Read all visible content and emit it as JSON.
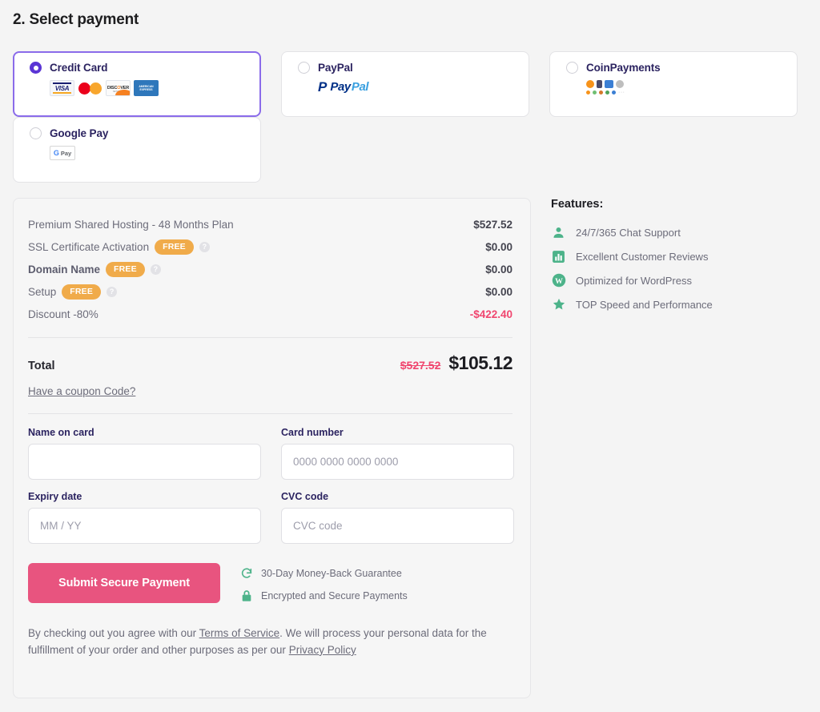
{
  "step": {
    "title": "2. Select payment"
  },
  "payment_methods": [
    {
      "id": "credit-card",
      "label": "Credit Card",
      "selected": true,
      "logos": [
        "visa",
        "mastercard",
        "discover",
        "amex"
      ]
    },
    {
      "id": "paypal",
      "label": "PayPal",
      "selected": false,
      "logos": [
        "paypal"
      ],
      "logo_text_1": "Pay",
      "logo_text_2": "Pal"
    },
    {
      "id": "coinpayments",
      "label": "CoinPayments",
      "selected": false,
      "logos": [
        "crypto"
      ]
    },
    {
      "id": "google-pay",
      "label": "Google Pay",
      "selected": false,
      "logos": [
        "gpay"
      ],
      "gpay_g": "G",
      "gpay_pay": "Pay"
    }
  ],
  "summary": {
    "items": [
      {
        "name": "Premium Shared Hosting - 48 Months Plan",
        "bold": false,
        "badge": "",
        "info": false,
        "amount": "$527.52",
        "negative": false
      },
      {
        "name": "SSL Certificate Activation",
        "bold": false,
        "badge": "FREE",
        "info": true,
        "amount": "$0.00",
        "negative": false
      },
      {
        "name": "Domain Name",
        "bold": true,
        "badge": "FREE",
        "info": true,
        "amount": "$0.00",
        "negative": false
      },
      {
        "name": "Setup",
        "bold": false,
        "badge": "FREE",
        "info": true,
        "amount": "$0.00",
        "negative": false
      },
      {
        "name": "Discount -80%",
        "bold": false,
        "badge": "",
        "info": false,
        "amount": "-$422.40",
        "negative": true
      }
    ],
    "total_label": "Total",
    "total_old": "$527.52",
    "total_new": "$105.12",
    "coupon_link": "Have a coupon Code?"
  },
  "form": {
    "name_on_card": {
      "label": "Name on card",
      "placeholder": "",
      "value": ""
    },
    "card_number": {
      "label": "Card number",
      "placeholder": "0000 0000 0000 0000",
      "value": ""
    },
    "expiry": {
      "label": "Expiry date",
      "placeholder": "MM / YY",
      "value": ""
    },
    "cvc": {
      "label": "CVC code",
      "placeholder": "CVC code",
      "value": ""
    },
    "submit_label": "Submit Secure Payment"
  },
  "trust": [
    {
      "icon": "refresh-icon",
      "text": "30-Day Money-Back Guarantee"
    },
    {
      "icon": "lock-icon",
      "text": "Encrypted and Secure Payments"
    }
  ],
  "legal": {
    "part1": "By checking out you agree with our ",
    "link1": "Terms of Service",
    "part2": ". We will process your personal data for the fulfillment of your order and other purposes as per our ",
    "link2": "Privacy Policy"
  },
  "features": {
    "title": "Features:",
    "items": [
      {
        "icon": "person-icon",
        "text": "24/7/365 Chat Support"
      },
      {
        "icon": "chart-icon",
        "text": "Excellent Customer Reviews"
      },
      {
        "icon": "wordpress-icon",
        "text": "Optimized for WordPress"
      },
      {
        "icon": "star-icon",
        "text": "TOP Speed and Performance"
      }
    ]
  },
  "colors": {
    "accent_purple": "#5b35d5",
    "selected_border": "#8a6bea",
    "submit_pink": "#e8547f",
    "discount_pink": "#f0466f",
    "badge_orange": "#f0ab4a",
    "feature_green": "#4db38a",
    "page_bg": "#f4f4f4"
  }
}
